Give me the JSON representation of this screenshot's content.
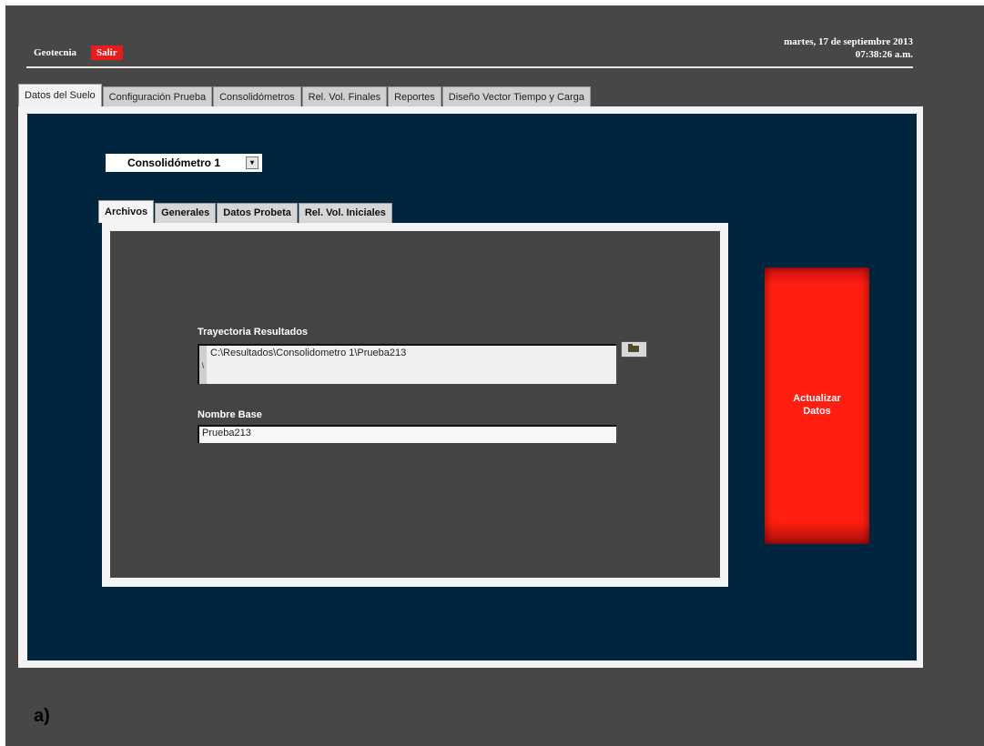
{
  "header": {
    "app_title": "Geotecnia",
    "exit_label": "Salir",
    "date": "martes, 17 de septiembre 2013",
    "time": "07:38:26 a.m."
  },
  "main_tabs": [
    {
      "label": "Datos del Suelo",
      "active": true
    },
    {
      "label": "Configuración Prueba"
    },
    {
      "label": "Consolidómetros"
    },
    {
      "label": "Rel. Vol. Finales"
    },
    {
      "label": "Reportes"
    },
    {
      "label": "Diseño Vector Tiempo y Carga"
    }
  ],
  "selector": {
    "value": "Consolidómetro 1",
    "arrow": "▾"
  },
  "sub_tabs": [
    {
      "label": "Archivos",
      "active": true
    },
    {
      "label": "Generales"
    },
    {
      "label": "Datos Probeta"
    },
    {
      "label": "Rel. Vol. Iniciales"
    }
  ],
  "files": {
    "path_label": "Trayectoria Resultados",
    "path_value": "C:\\Resultados\\Consolidometro 1\\Prueba213",
    "path_marker": "\\",
    "browse_icon": "folder-icon",
    "base_label": "Nombre Base",
    "base_value": "Prueba213"
  },
  "update_button": {
    "line1": "Actualizar",
    "line2": "Datos"
  },
  "figure_label": "a)",
  "colors": {
    "background": "#474747",
    "panel_navy": "#00263f",
    "panel_dark": "#444444",
    "accent_red": "#ff1e0f"
  }
}
